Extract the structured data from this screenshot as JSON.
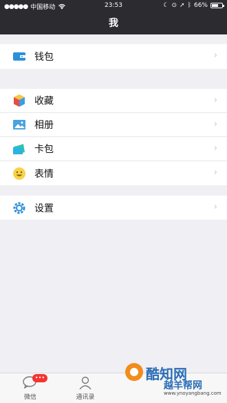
{
  "status_bar": {
    "carrier": "中国移动",
    "time": "23:53",
    "battery": "66%",
    "battery_level": 0.66
  },
  "nav": {
    "title": "我"
  },
  "menu": {
    "wallet": "钱包",
    "favorites": "收藏",
    "album": "相册",
    "cards": "卡包",
    "stickers": "表情",
    "settings": "设置"
  },
  "tabs": {
    "chats": "微信",
    "contacts": "通讯录"
  },
  "watermark": {
    "brand": "酷知网",
    "brand2": "越羊帮网",
    "url": "www.ynoyangbang.com"
  },
  "colors": {
    "bar_bg": "#2b2b30",
    "background": "#efeff4",
    "badge": "#f43530"
  },
  "icons": [
    "wifi-icon",
    "moon-icon",
    "lock-icon",
    "location-icon",
    "bluetooth-icon",
    "battery-icon",
    "wallet-icon",
    "favorites-icon",
    "album-icon",
    "cards-icon",
    "stickers-icon",
    "settings-icon",
    "chevron-right-icon",
    "chats-icon",
    "contacts-icon"
  ]
}
